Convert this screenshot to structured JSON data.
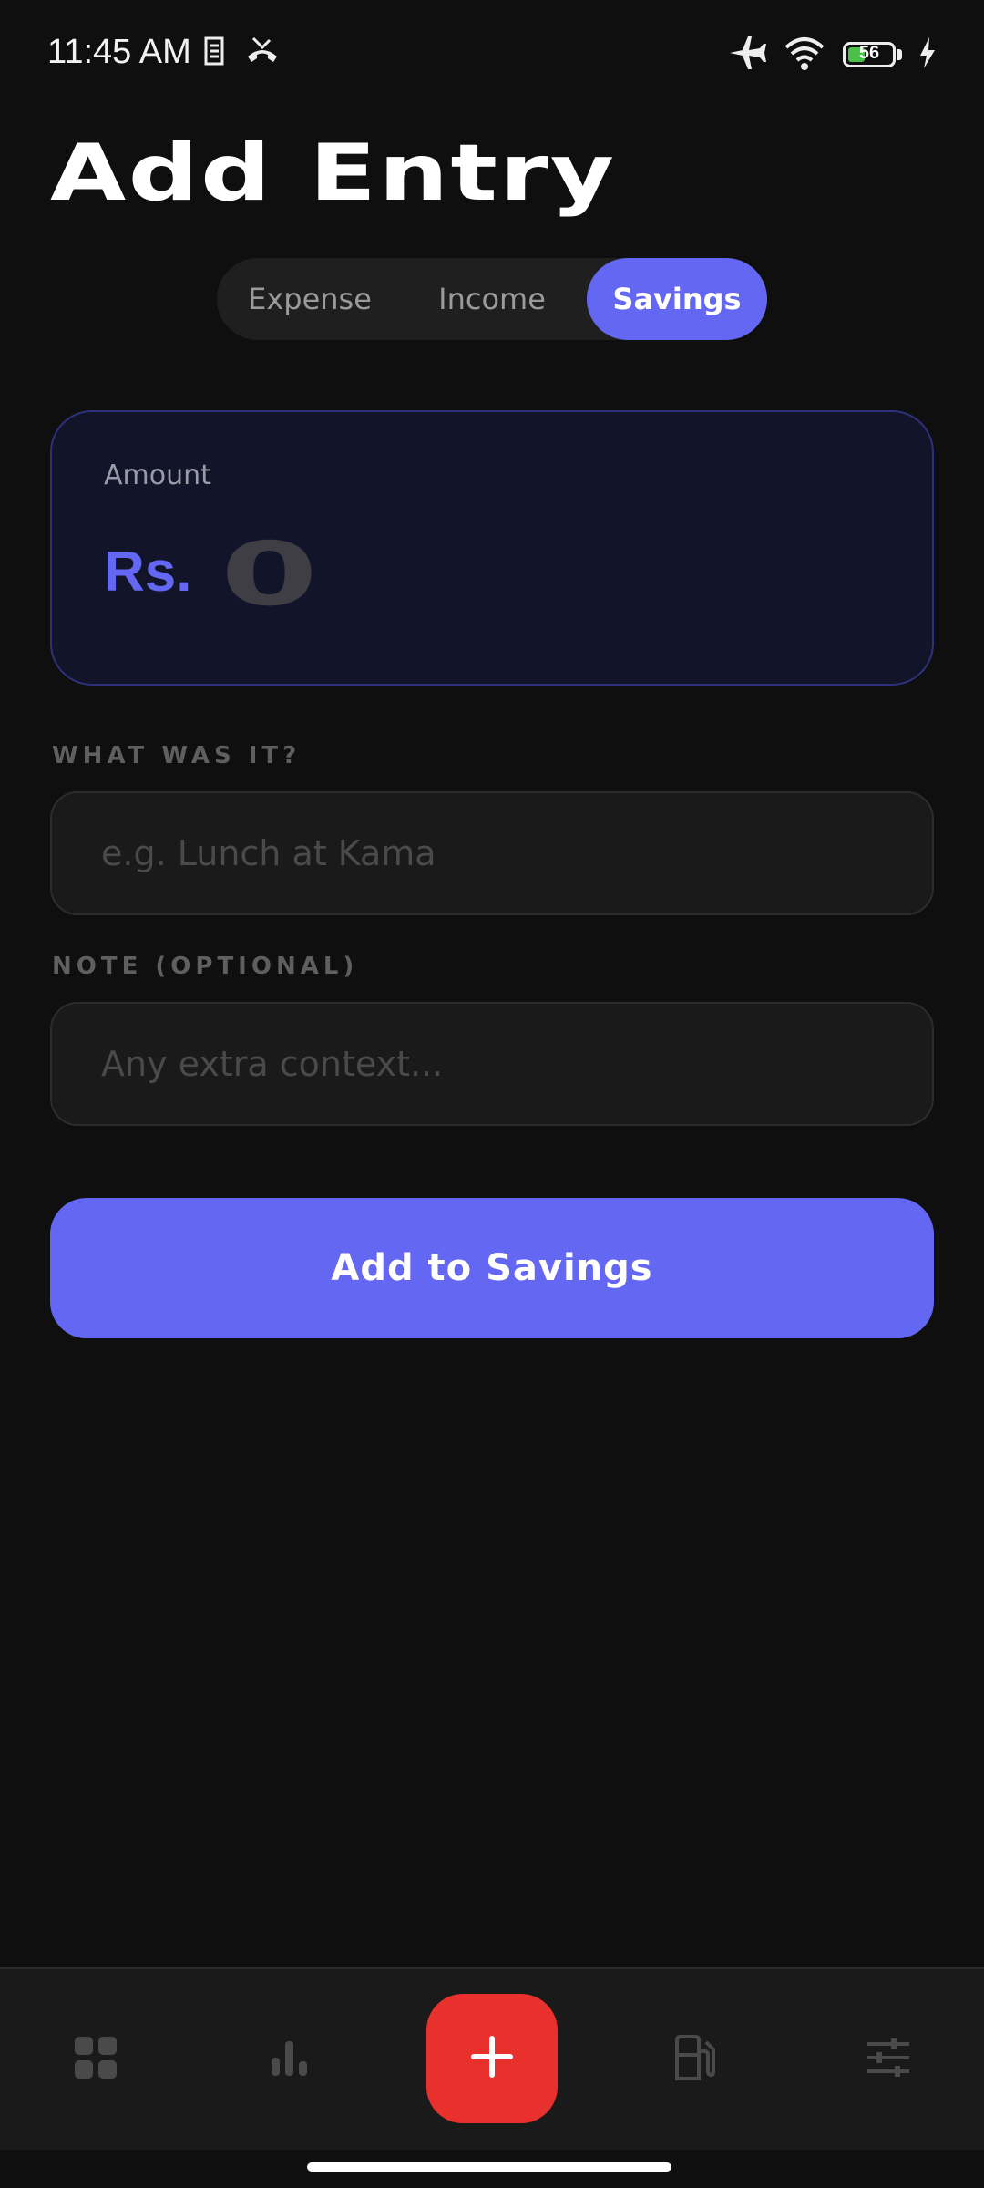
{
  "status_bar": {
    "time": "11:45 AM",
    "battery_level": "56",
    "icons": [
      "sim-icon",
      "missed-call-icon",
      "airplane-icon",
      "wifi-icon",
      "battery-icon",
      "charging-icon"
    ]
  },
  "page": {
    "title": "Add Entry"
  },
  "type_tabs": {
    "items": [
      {
        "label": "Expense",
        "active": false
      },
      {
        "label": "Income",
        "active": false
      },
      {
        "label": "Savings",
        "active": true
      }
    ]
  },
  "amount": {
    "label": "Amount",
    "prefix": "Rs.",
    "value": "0"
  },
  "description_field": {
    "label": "WHAT WAS IT?",
    "placeholder": "e.g. Lunch at Kama",
    "value": ""
  },
  "note_field": {
    "label": "NOTE (OPTIONAL)",
    "placeholder": "Any extra context...",
    "value": ""
  },
  "submit": {
    "label": "Add to Savings"
  },
  "bottom_nav": {
    "items": [
      "dashboard-icon",
      "stats-icon",
      "add-icon",
      "fuel-icon",
      "settings-icon"
    ]
  },
  "colors": {
    "accent": "#6467f2",
    "fab": "#e8302d",
    "background": "#0f0f0f",
    "card": "#12142a"
  }
}
